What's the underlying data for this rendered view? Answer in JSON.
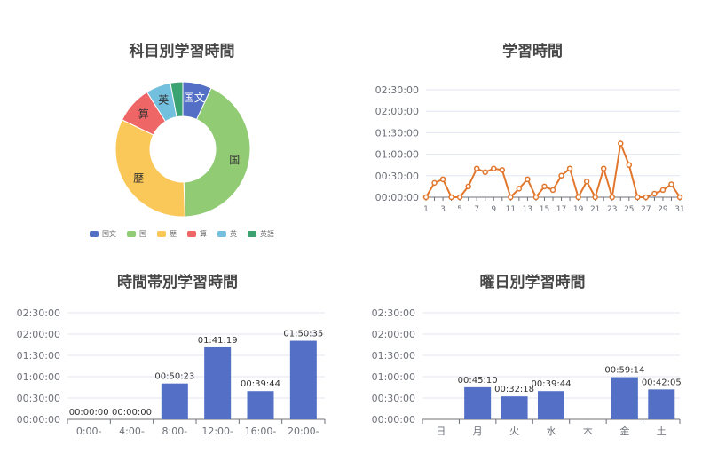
{
  "chart_data": [
    {
      "type": "pie",
      "title": "科目別学習時間",
      "categories": [
        "国文",
        "国",
        "歴",
        "算",
        "英",
        "英語"
      ],
      "values": [
        7,
        43,
        33,
        9,
        6,
        3
      ],
      "colors": [
        "#5470c6",
        "#91cc75",
        "#fac858",
        "#ee6666",
        "#73c0de",
        "#3ba272"
      ],
      "slice_labels": [
        "国文",
        "国",
        "歴",
        "算",
        "英",
        ""
      ],
      "legend": "bottom"
    },
    {
      "type": "line",
      "title": "学習時間",
      "x": [
        1,
        2,
        3,
        4,
        5,
        6,
        7,
        8,
        9,
        10,
        11,
        12,
        13,
        14,
        15,
        16,
        17,
        18,
        19,
        20,
        21,
        22,
        23,
        24,
        25,
        26,
        27,
        28,
        29,
        30,
        31
      ],
      "x_tick_labels": [
        "1",
        "3",
        "5",
        "7",
        "9",
        "11",
        "13",
        "15",
        "17",
        "19",
        "21",
        "23",
        "25",
        "27",
        "29",
        "31"
      ],
      "values_minutes": [
        0,
        20,
        25,
        0,
        0,
        15,
        40,
        35,
        40,
        38,
        0,
        12,
        25,
        0,
        15,
        10,
        30,
        40,
        0,
        22,
        0,
        40,
        0,
        75,
        45,
        0,
        0,
        5,
        10,
        18,
        0
      ],
      "y_tick_labels": [
        "00:00:00",
        "00:30:00",
        "01:00:00",
        "01:30:00",
        "02:00:00",
        "02:30:00"
      ],
      "ylim_minutes": [
        0,
        150
      ],
      "color": "#e1762c"
    },
    {
      "type": "bar",
      "title": "時間帯別学習時間",
      "categories": [
        "0:00-",
        "4:00-",
        "8:00-",
        "12:00-",
        "16:00-",
        "20:00-"
      ],
      "value_labels": [
        "00:00:00",
        "00:00:00",
        "00:50:23",
        "01:41:19",
        "00:39:44",
        "01:50:35"
      ],
      "values_minutes": [
        0,
        0,
        50.38,
        101.32,
        39.73,
        110.58
      ],
      "y_tick_labels": [
        "00:00:00",
        "00:30:00",
        "01:00:00",
        "01:30:00",
        "02:00:00",
        "02:30:00"
      ],
      "ylim_minutes": [
        0,
        150
      ],
      "color": "#5470c6"
    },
    {
      "type": "bar",
      "title": "曜日別学習時間",
      "categories": [
        "日",
        "月",
        "火",
        "水",
        "木",
        "金",
        "土"
      ],
      "value_labels": [
        "",
        "00:45:10",
        "00:32:18",
        "00:39:44",
        "",
        "00:59:14",
        "00:42:05"
      ],
      "values_minutes": [
        0,
        45.17,
        32.3,
        39.73,
        0,
        59.23,
        42.08
      ],
      "y_tick_labels": [
        "00:00:00",
        "00:30:00",
        "01:00:00",
        "01:30:00",
        "02:00:00",
        "02:30:00"
      ],
      "ylim_minutes": [
        0,
        150
      ],
      "color": "#5470c6"
    }
  ]
}
